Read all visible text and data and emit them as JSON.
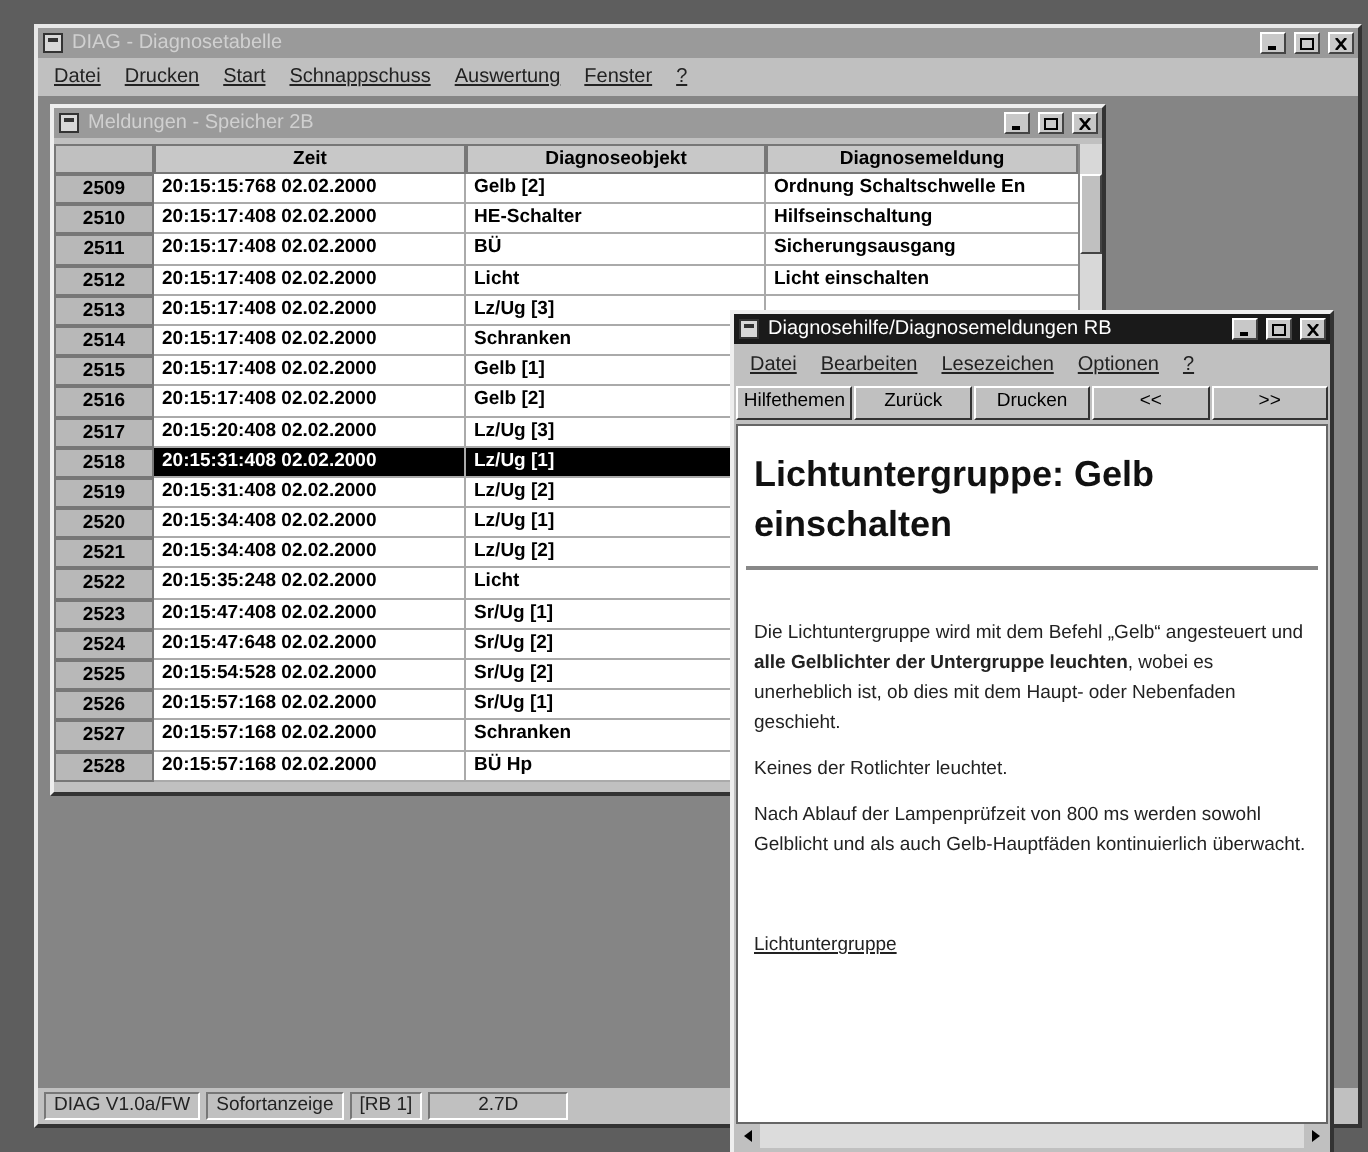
{
  "main_window": {
    "title": "DIAG - Diagnosetabelle",
    "active": false,
    "menu": [
      "Datei",
      "Drucken",
      "Start",
      "Schnappschuss",
      "Auswertung",
      "Fenster",
      "?"
    ]
  },
  "table_window": {
    "title": "Meldungen - Speicher 2B",
    "active": false,
    "columns": [
      "Zeit",
      "Diagnoseobjekt",
      "Diagnosemeldung"
    ],
    "rows": [
      {
        "number": "2509",
        "time": "20:15:15:768 02.02.2000",
        "object": "Gelb [2]",
        "message": "Ordnung Schaltschwelle En",
        "selected": false
      },
      {
        "number": "2510",
        "time": "20:15:17:408 02.02.2000",
        "object": "HE-Schalter",
        "message": "Hilfseinschaltung",
        "selected": false
      },
      {
        "number": "2511",
        "time": "20:15:17:408 02.02.2000",
        "object": "BÜ",
        "message": "Sicherungsausgang",
        "selected": false
      },
      {
        "number": "2512",
        "time": "20:15:17:408 02.02.2000",
        "object": "Licht",
        "message": "Licht einschalten",
        "selected": false
      },
      {
        "number": "2513",
        "time": "20:15:17:408 02.02.2000",
        "object": "Lz/Ug [3]",
        "selected": false
      },
      {
        "number": "2514",
        "time": "20:15:17:408 02.02.2000",
        "object": "Schranken",
        "selected": false
      },
      {
        "number": "2515",
        "time": "20:15:17:408 02.02.2000",
        "object": "Gelb [1]",
        "selected": false
      },
      {
        "number": "2516",
        "time": "20:15:17:408 02.02.2000",
        "object": "Gelb [2]",
        "selected": false
      },
      {
        "number": "2517",
        "time": "20:15:20:408 02.02.2000",
        "object": "Lz/Ug [3]",
        "selected": false
      },
      {
        "number": "2518",
        "time": "20:15:31:408 02.02.2000",
        "object": "Lz/Ug [1]",
        "selected": true
      },
      {
        "number": "2519",
        "time": "20:15:31:408 02.02.2000",
        "object": "Lz/Ug [2]",
        "selected": false
      },
      {
        "number": "2520",
        "time": "20:15:34:408 02.02.2000",
        "object": "Lz/Ug [1]",
        "selected": false
      },
      {
        "number": "2521",
        "time": "20:15:34:408 02.02.2000",
        "object": "Lz/Ug [2]",
        "selected": false
      },
      {
        "number": "2522",
        "time": "20:15:35:248 02.02.2000",
        "object": "Licht",
        "selected": false
      },
      {
        "number": "2523",
        "time": "20:15:47:408 02.02.2000",
        "object": "Sr/Ug [1]",
        "selected": false
      },
      {
        "number": "2524",
        "time": "20:15:47:648 02.02.2000",
        "object": "Sr/Ug [2]",
        "selected": false
      },
      {
        "number": "2525",
        "time": "20:15:54:528 02.02.2000",
        "object": "Sr/Ug [2]",
        "selected": false
      },
      {
        "number": "2526",
        "time": "20:15:57:168 02.02.2000",
        "object": "Sr/Ug [1]",
        "selected": false
      },
      {
        "number": "2527",
        "time": "20:15:57:168 02.02.2000",
        "object": "Schranken",
        "selected": false
      },
      {
        "number": "2528",
        "time": "20:15:57:168 02.02.2000",
        "object": "BÜ Hp",
        "selected": false
      }
    ]
  },
  "status_bar": [
    "DIAG V1.0a/FW",
    "Sofortanzeige",
    "[RB 1]",
    "2.7D"
  ],
  "help_window": {
    "title": "Diagnosehilfe/Diagnosemeldungen RB",
    "active": true,
    "menu": [
      "Datei",
      "Bearbeiten",
      "Lesezeichen",
      "Optionen",
      "?"
    ],
    "buttons": [
      "Hilfethemen",
      "Zurück",
      "Drucken",
      "<<",
      ">>"
    ],
    "heading": "Lichtuntergruppe: Gelb einschalten",
    "paragraphs": [
      "Die Lichtuntergruppe wird mit dem Befehl „Gelb“ angesteuert und **alle Gelblichter der Untergruppe leuchten**, wobei es unerheblich ist, ob dies mit dem Haupt- oder Nebenfaden geschieht.",
      "Keines der Rotlichter leuchtet.",
      "Nach Ablauf der Lampenprüfzeit von 800 ms werden sowohl Gelblicht und als auch Gelb-Hauptfäden kontinuierlich überwacht."
    ],
    "link": "Lichtuntergruppe"
  }
}
